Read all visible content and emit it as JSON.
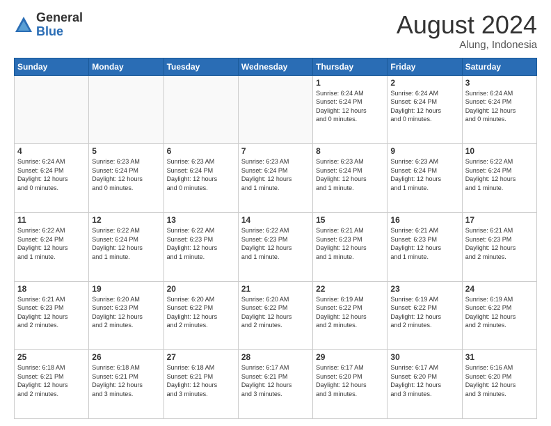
{
  "header": {
    "logo_line1": "General",
    "logo_line2": "Blue",
    "month_title": "August 2024",
    "location": "Alung, Indonesia"
  },
  "weekdays": [
    "Sunday",
    "Monday",
    "Tuesday",
    "Wednesday",
    "Thursday",
    "Friday",
    "Saturday"
  ],
  "weeks": [
    [
      {
        "day": "",
        "info": "",
        "empty": true
      },
      {
        "day": "",
        "info": "",
        "empty": true
      },
      {
        "day": "",
        "info": "",
        "empty": true
      },
      {
        "day": "",
        "info": "",
        "empty": true
      },
      {
        "day": "1",
        "info": "Sunrise: 6:24 AM\nSunset: 6:24 PM\nDaylight: 12 hours\nand 0 minutes."
      },
      {
        "day": "2",
        "info": "Sunrise: 6:24 AM\nSunset: 6:24 PM\nDaylight: 12 hours\nand 0 minutes."
      },
      {
        "day": "3",
        "info": "Sunrise: 6:24 AM\nSunset: 6:24 PM\nDaylight: 12 hours\nand 0 minutes."
      }
    ],
    [
      {
        "day": "4",
        "info": "Sunrise: 6:24 AM\nSunset: 6:24 PM\nDaylight: 12 hours\nand 0 minutes."
      },
      {
        "day": "5",
        "info": "Sunrise: 6:23 AM\nSunset: 6:24 PM\nDaylight: 12 hours\nand 0 minutes."
      },
      {
        "day": "6",
        "info": "Sunrise: 6:23 AM\nSunset: 6:24 PM\nDaylight: 12 hours\nand 0 minutes."
      },
      {
        "day": "7",
        "info": "Sunrise: 6:23 AM\nSunset: 6:24 PM\nDaylight: 12 hours\nand 1 minute."
      },
      {
        "day": "8",
        "info": "Sunrise: 6:23 AM\nSunset: 6:24 PM\nDaylight: 12 hours\nand 1 minute."
      },
      {
        "day": "9",
        "info": "Sunrise: 6:23 AM\nSunset: 6:24 PM\nDaylight: 12 hours\nand 1 minute."
      },
      {
        "day": "10",
        "info": "Sunrise: 6:22 AM\nSunset: 6:24 PM\nDaylight: 12 hours\nand 1 minute."
      }
    ],
    [
      {
        "day": "11",
        "info": "Sunrise: 6:22 AM\nSunset: 6:24 PM\nDaylight: 12 hours\nand 1 minute."
      },
      {
        "day": "12",
        "info": "Sunrise: 6:22 AM\nSunset: 6:24 PM\nDaylight: 12 hours\nand 1 minute."
      },
      {
        "day": "13",
        "info": "Sunrise: 6:22 AM\nSunset: 6:23 PM\nDaylight: 12 hours\nand 1 minute."
      },
      {
        "day": "14",
        "info": "Sunrise: 6:22 AM\nSunset: 6:23 PM\nDaylight: 12 hours\nand 1 minute."
      },
      {
        "day": "15",
        "info": "Sunrise: 6:21 AM\nSunset: 6:23 PM\nDaylight: 12 hours\nand 1 minute."
      },
      {
        "day": "16",
        "info": "Sunrise: 6:21 AM\nSunset: 6:23 PM\nDaylight: 12 hours\nand 1 minute."
      },
      {
        "day": "17",
        "info": "Sunrise: 6:21 AM\nSunset: 6:23 PM\nDaylight: 12 hours\nand 2 minutes."
      }
    ],
    [
      {
        "day": "18",
        "info": "Sunrise: 6:21 AM\nSunset: 6:23 PM\nDaylight: 12 hours\nand 2 minutes."
      },
      {
        "day": "19",
        "info": "Sunrise: 6:20 AM\nSunset: 6:23 PM\nDaylight: 12 hours\nand 2 minutes."
      },
      {
        "day": "20",
        "info": "Sunrise: 6:20 AM\nSunset: 6:22 PM\nDaylight: 12 hours\nand 2 minutes."
      },
      {
        "day": "21",
        "info": "Sunrise: 6:20 AM\nSunset: 6:22 PM\nDaylight: 12 hours\nand 2 minutes."
      },
      {
        "day": "22",
        "info": "Sunrise: 6:19 AM\nSunset: 6:22 PM\nDaylight: 12 hours\nand 2 minutes."
      },
      {
        "day": "23",
        "info": "Sunrise: 6:19 AM\nSunset: 6:22 PM\nDaylight: 12 hours\nand 2 minutes."
      },
      {
        "day": "24",
        "info": "Sunrise: 6:19 AM\nSunset: 6:22 PM\nDaylight: 12 hours\nand 2 minutes."
      }
    ],
    [
      {
        "day": "25",
        "info": "Sunrise: 6:18 AM\nSunset: 6:21 PM\nDaylight: 12 hours\nand 2 minutes."
      },
      {
        "day": "26",
        "info": "Sunrise: 6:18 AM\nSunset: 6:21 PM\nDaylight: 12 hours\nand 3 minutes."
      },
      {
        "day": "27",
        "info": "Sunrise: 6:18 AM\nSunset: 6:21 PM\nDaylight: 12 hours\nand 3 minutes."
      },
      {
        "day": "28",
        "info": "Sunrise: 6:17 AM\nSunset: 6:21 PM\nDaylight: 12 hours\nand 3 minutes."
      },
      {
        "day": "29",
        "info": "Sunrise: 6:17 AM\nSunset: 6:20 PM\nDaylight: 12 hours\nand 3 minutes."
      },
      {
        "day": "30",
        "info": "Sunrise: 6:17 AM\nSunset: 6:20 PM\nDaylight: 12 hours\nand 3 minutes."
      },
      {
        "day": "31",
        "info": "Sunrise: 6:16 AM\nSunset: 6:20 PM\nDaylight: 12 hours\nand 3 minutes."
      }
    ]
  ]
}
